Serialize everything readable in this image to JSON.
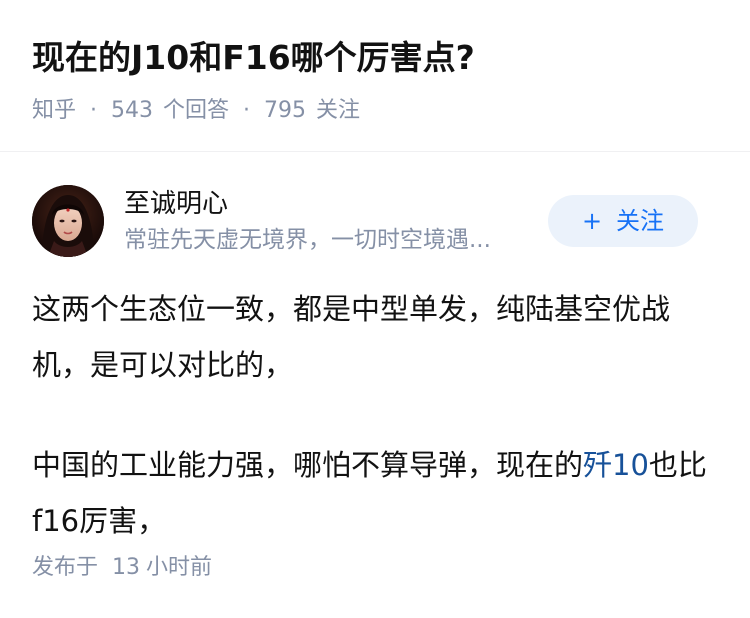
{
  "question": {
    "title": "现在的J10和F16哪个厉害点?",
    "meta": {
      "source": "知乎",
      "separator": "·",
      "answer_count": "543",
      "answer_label": "个回答",
      "follower_count": "795",
      "follower_label": "关注"
    }
  },
  "author": {
    "name": "至诚明心",
    "bio": "常驻先天虚无境界，一切时空境遇...",
    "avatar_icon": "user-avatar-portrait",
    "follow_button": {
      "icon": "+",
      "label": "关注"
    }
  },
  "answer": {
    "paragraph_1": "这两个生态位一致，都是中型单发，纯陆基空优战机，是可以对比的，",
    "paragraph_2_before": "中国的工业能力强，哪怕不算导弹，现在的",
    "paragraph_2_link": "歼10",
    "paragraph_2_after": "也比f16厉害，"
  },
  "footer": {
    "published_label": "发布于",
    "time_value": "13",
    "time_unit": "小时前"
  },
  "colors": {
    "accent": "#1772f6",
    "link": "#175199",
    "meta_gray": "#8590a6",
    "follow_bg": "#ebf2fb",
    "text": "#121212"
  }
}
